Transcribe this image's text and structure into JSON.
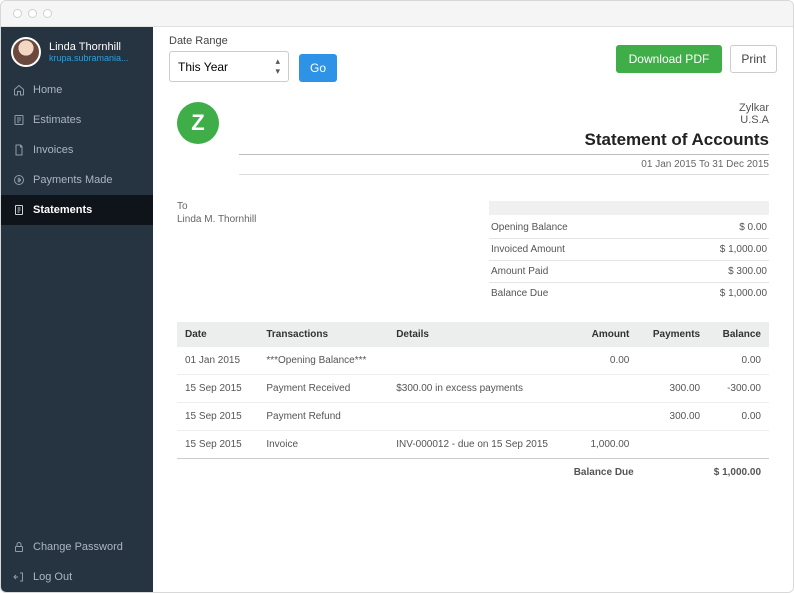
{
  "user": {
    "name": "Linda Thornhill",
    "email": "krupa.subramania..."
  },
  "sidebar": {
    "items": [
      {
        "label": "Home"
      },
      {
        "label": "Estimates"
      },
      {
        "label": "Invoices"
      },
      {
        "label": "Payments Made"
      },
      {
        "label": "Statements"
      }
    ],
    "bottom": [
      {
        "label": "Change Password"
      },
      {
        "label": "Log Out"
      }
    ]
  },
  "toolbar": {
    "date_range_label": "Date Range",
    "date_range_value": "This Year",
    "go_label": "Go",
    "download_label": "Download PDF",
    "print_label": "Print"
  },
  "doc": {
    "logo_letter": "Z",
    "org_name": "Zylkar",
    "org_country": "U.S.A",
    "statement_title": "Statement of Accounts",
    "date_range_text": "01 Jan 2015 To 31 Dec 2015",
    "to_label": "To",
    "to_name": "Linda M. Thornhill",
    "summary": [
      {
        "label": "Opening Balance",
        "value": "$ 0.00"
      },
      {
        "label": "Invoiced Amount",
        "value": "$ 1,000.00"
      },
      {
        "label": "Amount Paid",
        "value": "$ 300.00"
      },
      {
        "label": "Balance Due",
        "value": "$ 1,000.00"
      }
    ],
    "columns": {
      "date": "Date",
      "transactions": "Transactions",
      "details": "Details",
      "amount": "Amount",
      "payments": "Payments",
      "balance": "Balance"
    },
    "rows": [
      {
        "date": "01 Jan 2015",
        "tx": "***Opening Balance***",
        "details": "",
        "amount": "0.00",
        "payments": "",
        "balance": "0.00"
      },
      {
        "date": "15 Sep 2015",
        "tx": "Payment Received",
        "details": "$300.00 in excess payments",
        "amount": "",
        "payments": "300.00",
        "balance": "-300.00"
      },
      {
        "date": "15 Sep 2015",
        "tx": "Payment Refund",
        "details": "",
        "amount": "",
        "payments": "300.00",
        "balance": "0.00"
      },
      {
        "date": "15 Sep 2015",
        "tx": "Invoice",
        "details": "INV-000012 - due on 15 Sep 2015",
        "amount": "1,000.00",
        "payments": "",
        "balance": ""
      }
    ],
    "balance_due_label": "Balance Due",
    "balance_due_value": "$ 1,000.00"
  }
}
